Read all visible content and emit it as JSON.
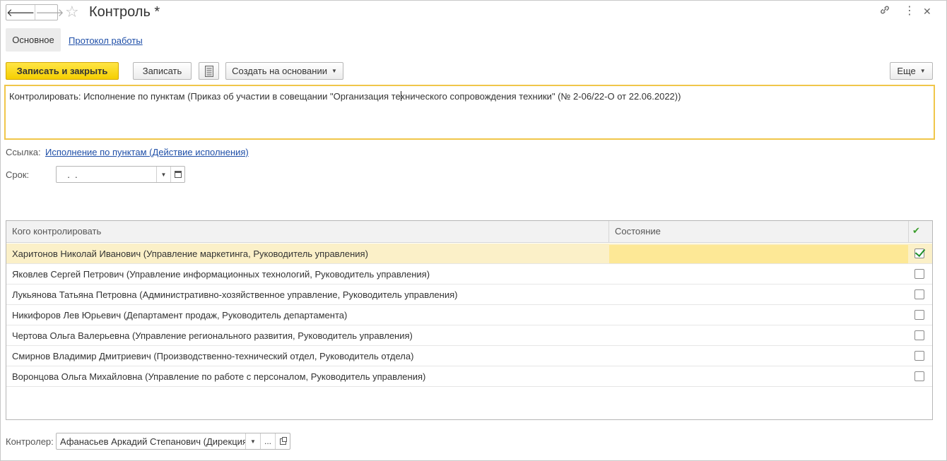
{
  "window": {
    "title": "Контроль *",
    "icons": [
      "back-arrow-icon",
      "forward-arrow-icon",
      "star-icon",
      "link-icon",
      "more-icon",
      "close-icon"
    ]
  },
  "tabs": {
    "main": "Основное",
    "log": "Протокол работы"
  },
  "toolbar": {
    "save_close": "Записать и закрыть",
    "save": "Записать",
    "create_based": "Создать на основании",
    "more": "Еще"
  },
  "control_text": {
    "before_caret": "Контролировать: Исполнение по пунктам (Приказ об участии в совещании \"Организация те",
    "after_caret": "хнического сопровождения техники\" (№ 2-06/22-О от 22.06.2022))"
  },
  "reference": {
    "label": "Ссылка:",
    "link": "Исполнение по пунктам (Действие исполнения)"
  },
  "deadline": {
    "label": "Срок:",
    "value": "  .  ."
  },
  "table": {
    "headers": [
      "Кого контролировать",
      "Состояние"
    ],
    "rows": [
      {
        "name": "Харитонов Николай Иванович (Управление маркетинга, Руководитель управления)",
        "state": "",
        "checked": true,
        "selected": true
      },
      {
        "name": "Яковлев Сергей Петрович (Управление информационных технологий, Руководитель управления)",
        "state": "",
        "checked": false,
        "selected": false
      },
      {
        "name": "Лукьянова Татьяна Петровна (Административно-хозяйственное управление, Руководитель управления)",
        "state": "",
        "checked": false,
        "selected": false
      },
      {
        "name": "Никифоров Лев Юрьевич (Департамент продаж, Руководитель департамента)",
        "state": "",
        "checked": false,
        "selected": false
      },
      {
        "name": "Чертова Ольга Валерьевна (Управление регионального развития, Руководитель управления)",
        "state": "",
        "checked": false,
        "selected": false
      },
      {
        "name": "Смирнов Владимир Дмитриевич (Производственно-технический отдел, Руководитель отдела)",
        "state": "",
        "checked": false,
        "selected": false
      },
      {
        "name": "Воронцова Ольга Михайловна (Управление по работе с персоналом, Руководитель управления)",
        "state": "",
        "checked": false,
        "selected": false
      }
    ]
  },
  "controller": {
    "label": "Контролер:",
    "value": "Афанасьев Аркадий Степанович (Дирекция",
    "choose": "..."
  },
  "colors": {
    "accent_yellow": "#f5cf00",
    "selected_row": "#fbf0c8",
    "link": "#1f4fa8",
    "check_green": "#1f8f2a"
  }
}
